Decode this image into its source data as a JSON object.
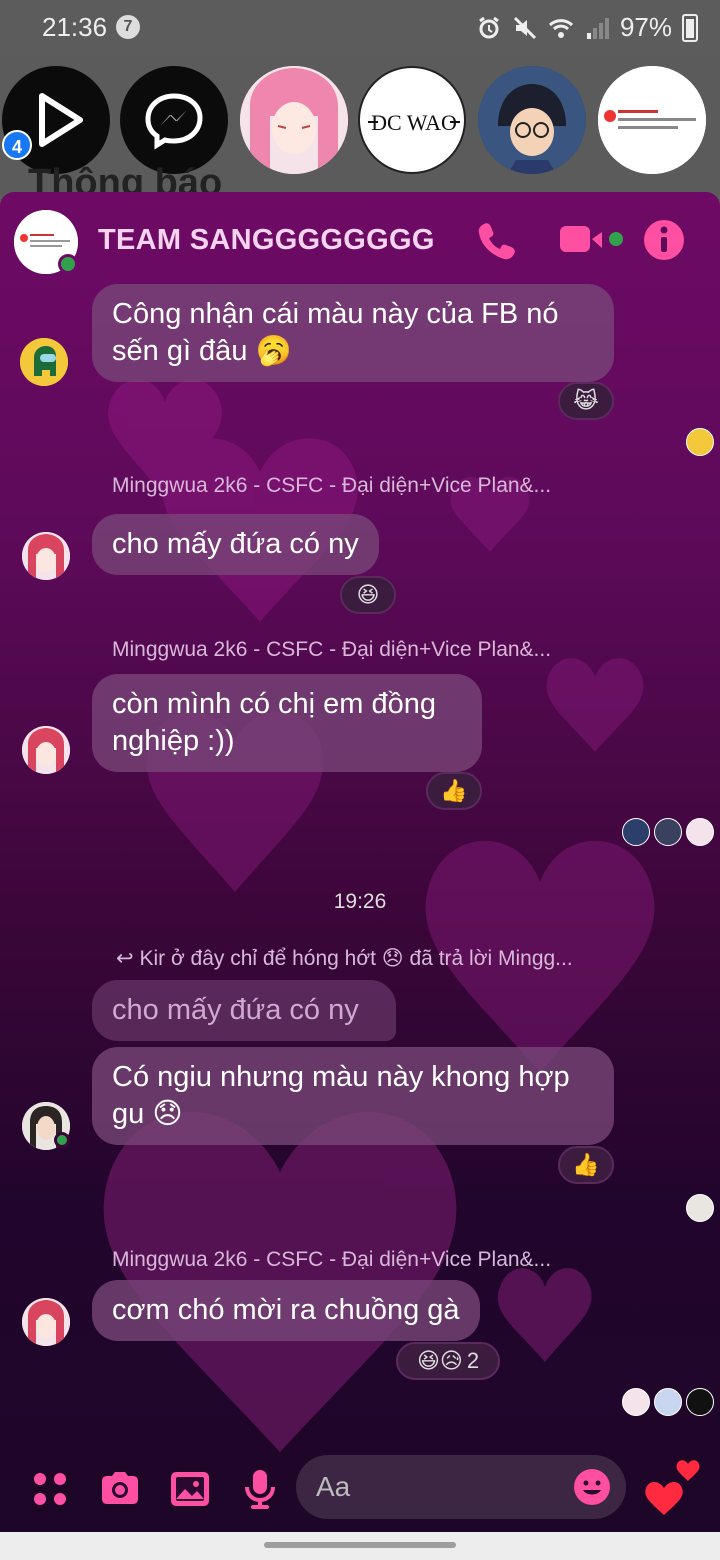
{
  "status": {
    "time": "21:36",
    "notif_count": "7",
    "battery": "97%"
  },
  "heads": {
    "badge": "4",
    "logo_text": "DC WAO"
  },
  "background_title": "Thông báo",
  "chat": {
    "title": "TEAM SANGGGGGGGG",
    "accent": "#ff4fa3",
    "messages": [
      {
        "text_line1": "Công nhận cái màu này của FB nó",
        "text_line2": "sến gì đâu 🥱",
        "reaction": "😹"
      },
      {
        "sender": "Minggwua 2k6 - CSFC - Đại diện+Vice Plan&...",
        "text": "cho mấy đứa có ny",
        "reaction": "😆"
      },
      {
        "sender": "Minggwua 2k6 - CSFC - Đại diện+Vice Plan&...",
        "text_line1": "còn mình có chị em đồng",
        "text_line2": "nghiệp :))",
        "reaction": "👍"
      },
      {
        "timestamp": "19:26"
      },
      {
        "reply_note": "Kir ở đây chỉ để hóng hớt 😞 đã trả lời Mingg...",
        "quoted": "cho mấy đứa có ny",
        "text_line1": "Có ngiu nhưng màu này khong hợp",
        "text_line2": "gu 😞",
        "reaction": "👍"
      },
      {
        "sender": "Minggwua 2k6 - CSFC - Đại diện+Vice Plan&...",
        "text": "cơm chó mời ra chuồng gà",
        "reaction": "😆😥",
        "reaction_count": "2"
      }
    ],
    "composer_placeholder": "Aa"
  }
}
